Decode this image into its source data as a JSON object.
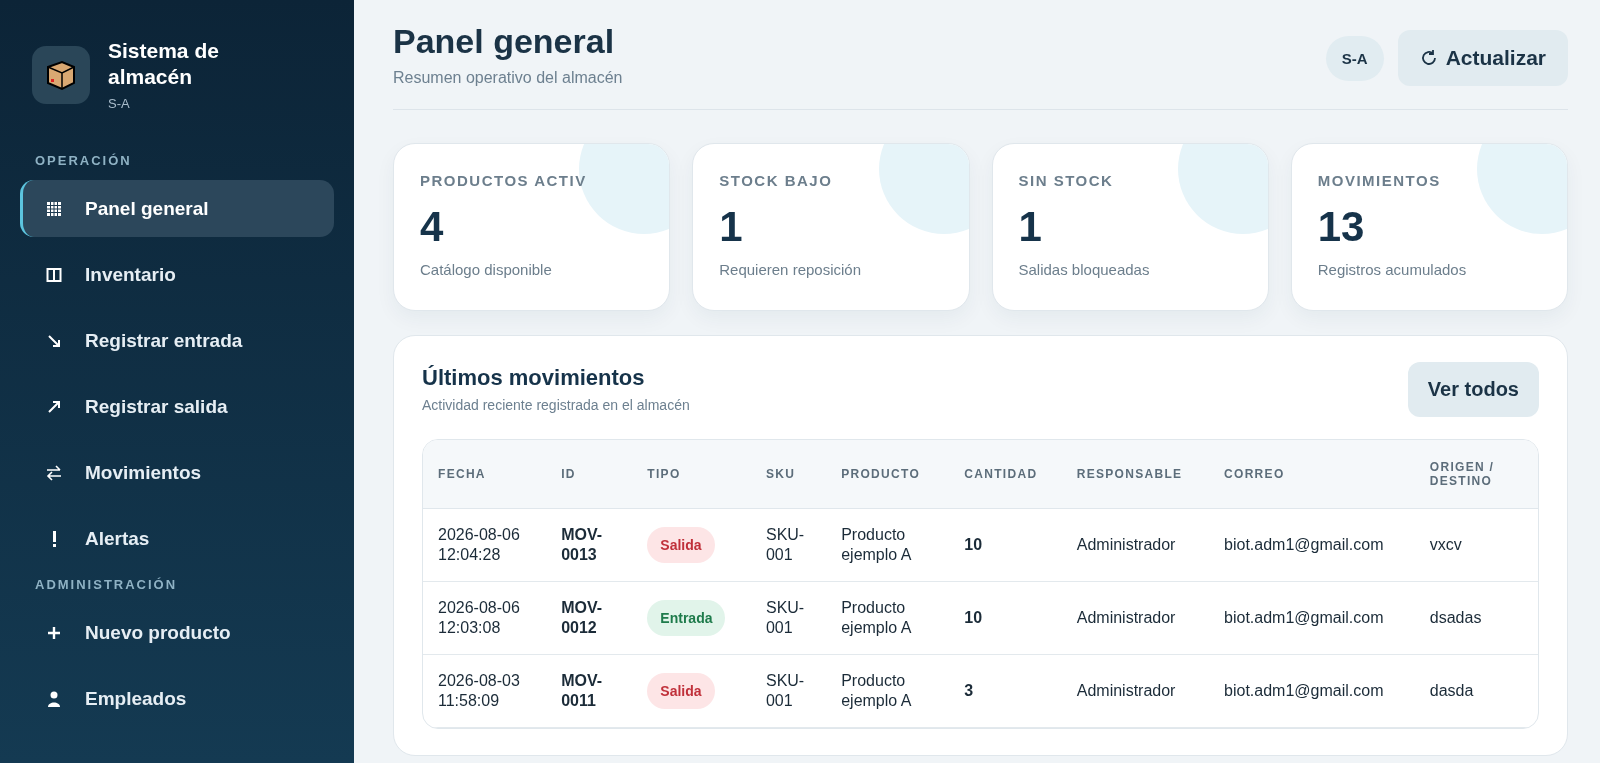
{
  "brand": {
    "title": "Sistema de almacén",
    "subtitle": "S-A"
  },
  "sidebar": {
    "sections": [
      {
        "heading": "OPERACIÓN",
        "items": [
          {
            "label": "Panel general",
            "kind": "grid",
            "selected": true
          },
          {
            "label": "Inventario",
            "kind": "columns",
            "selected": false
          },
          {
            "label": "Registrar entrada",
            "kind": "incoming",
            "selected": false
          },
          {
            "label": "Registrar salida",
            "kind": "outgoing",
            "selected": false
          },
          {
            "label": "Movimientos",
            "kind": "swap",
            "selected": false
          },
          {
            "label": "Alertas",
            "kind": "alert",
            "selected": false
          }
        ]
      },
      {
        "heading": "ADMINISTRACIÓN",
        "items": [
          {
            "label": "Nuevo producto",
            "kind": "add",
            "selected": false
          },
          {
            "label": "Empleados",
            "kind": "people",
            "selected": false
          }
        ]
      }
    ]
  },
  "header": {
    "title": "Panel general",
    "subtitle": "Resumen operativo del almacén",
    "badge": "S-A",
    "refresh_button": "Actualizar"
  },
  "stats": [
    {
      "label": "PRODUCTOS ACTIV",
      "value": "4",
      "note": "Catálogo disponible"
    },
    {
      "label": "STOCK BAJO",
      "value": "1",
      "note": "Requieren reposición"
    },
    {
      "label": "SIN STOCK",
      "value": "1",
      "note": "Salidas bloqueadas"
    },
    {
      "label": "MOVIMIENTOS",
      "value": "13",
      "note": "Registros acumulados"
    }
  ],
  "movements": {
    "title": "Últimos movimientos",
    "subtitle": "Actividad reciente registrada en el almacén",
    "view_all_button": "Ver todos",
    "columns": [
      "FECHA",
      "ID",
      "TIPO",
      "SKU",
      "PRODUCTO",
      "CANTIDAD",
      "RESPONSABLE",
      "CORREO",
      "ORIGEN / DESTINO"
    ],
    "rows": [
      {
        "fecha": "2026-08-06 12:04:28",
        "id": "MOV-0013",
        "tipo": {
          "kind": "salida",
          "label": "Salida"
        },
        "sku": "SKU-001",
        "producto": "Producto ejemplo A",
        "cantidad": "10",
        "responsable": "Administrador",
        "correo": "biot.adm1@gmail.com",
        "origen": "vxcv"
      },
      {
        "fecha": "2026-08-06 12:03:08",
        "id": "MOV-0012",
        "tipo": {
          "kind": "entrada",
          "label": "Entrada"
        },
        "sku": "SKU-001",
        "producto": "Producto ejemplo A",
        "cantidad": "10",
        "responsable": "Administrador",
        "correo": "biot.adm1@gmail.com",
        "origen": "dsadas"
      },
      {
        "fecha": "2026-08-03 11:58:09",
        "id": "MOV-0011",
        "tipo": {
          "kind": "salida",
          "label": "Salida"
        },
        "sku": "SKU-001",
        "producto": "Producto ejemplo A",
        "cantidad": "3",
        "responsable": "Administrador",
        "correo": "biot.adm1@gmail.com",
        "origen": "dasda"
      }
    ]
  }
}
